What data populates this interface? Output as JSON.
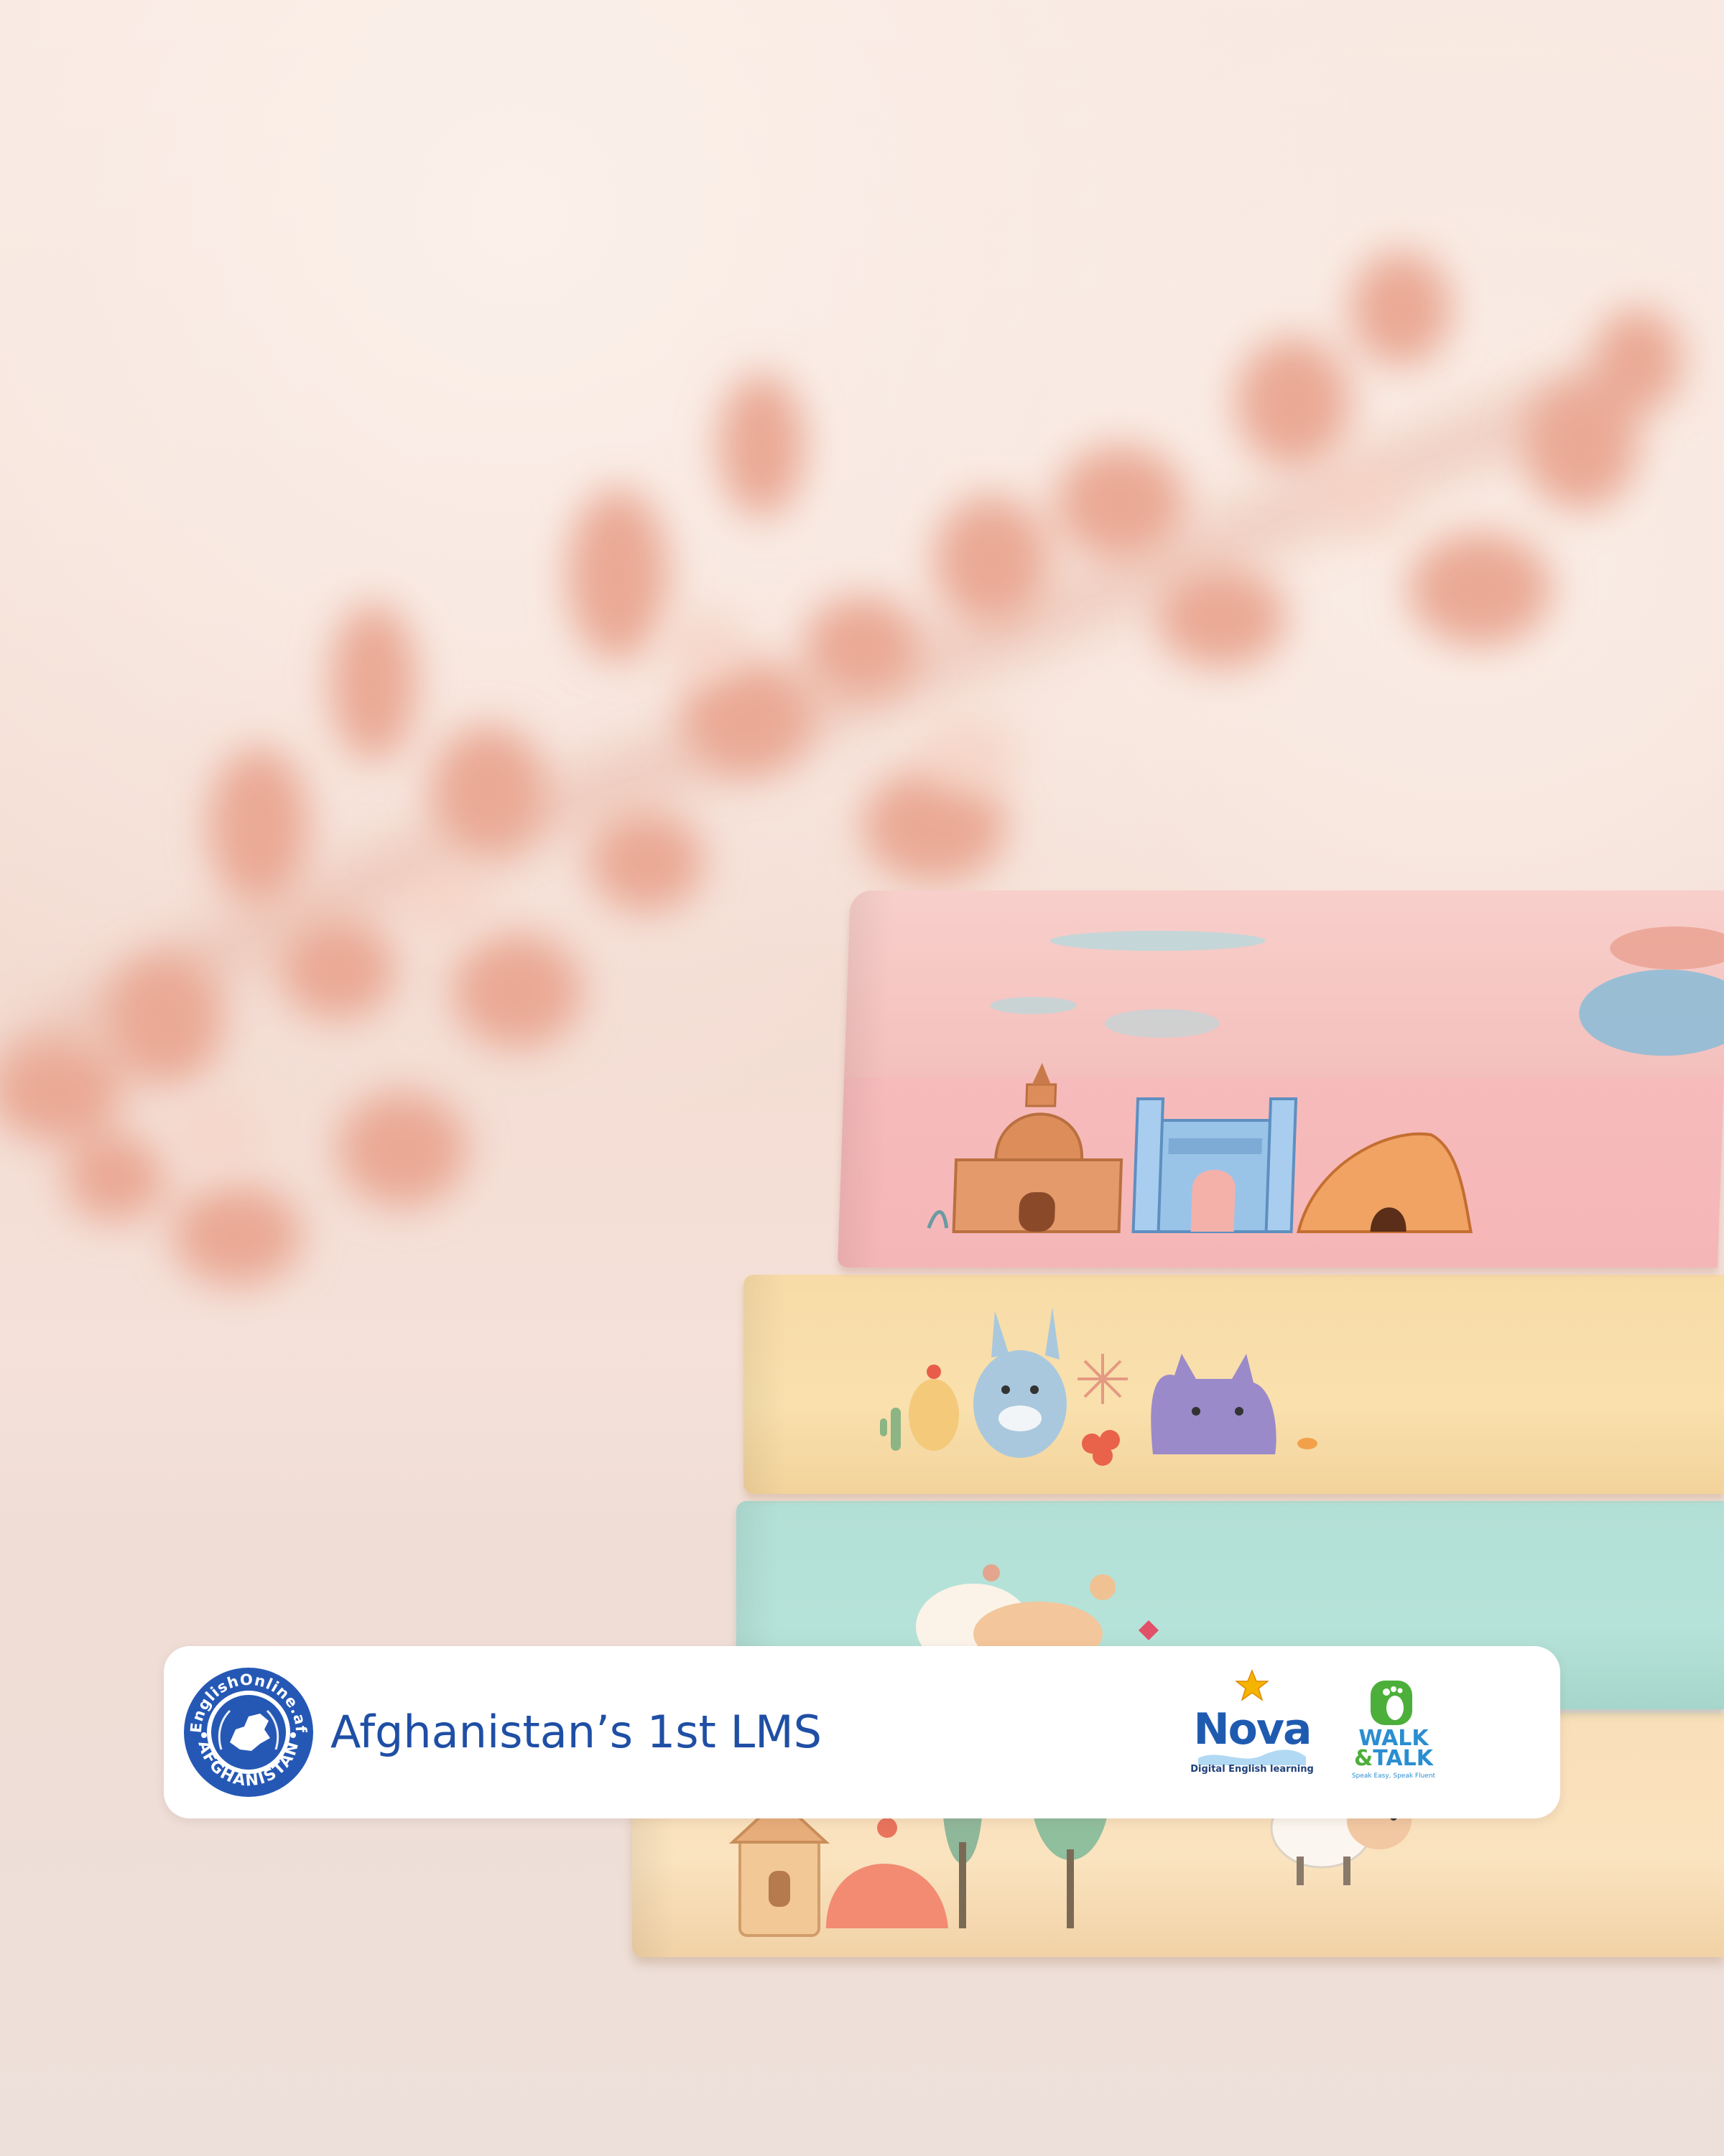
{
  "banner": {
    "tagline": "Afghanistan’s 1st LMS",
    "seal": {
      "ring_text": "EnglishOnline.af",
      "bottom_text": "AFGHANISTAN",
      "icon": "afghanistan-map-emblem-icon"
    },
    "partner_logos": [
      {
        "name": "Nova",
        "subtitle": "Digital English learning",
        "icon": "star-icon"
      },
      {
        "name_line1": "WALK",
        "name_amp": "&",
        "name_line2": "TALK",
        "subtitle": "Speak Easy, Speak Fluent",
        "icon": "footprint-icon"
      }
    ]
  },
  "colors": {
    "brand_blue": "#1f4fa5",
    "nova_blue": "#1e5bb0",
    "star_gold": "#f5b400",
    "walk_blue": "#2a8ed1",
    "walk_green": "#4caf3a",
    "book_pink": "#f5b6b7",
    "book_yellow": "#f9e0ad",
    "book_teal": "#b6e3d9",
    "book_peach": "#fae3bf"
  }
}
